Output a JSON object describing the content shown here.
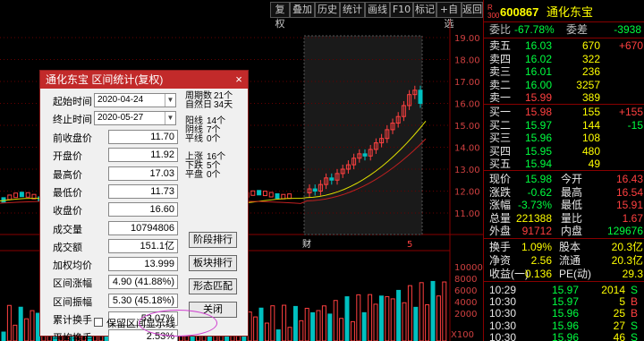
{
  "toolbar": [
    "复权",
    "叠加",
    "历史",
    "统计",
    "画线",
    "F10",
    "标记",
    "+自选",
    "返回"
  ],
  "chart": {
    "price_axis": [
      "19.00",
      "18.00",
      "17.00",
      "16.00",
      "15.00",
      "14.00",
      "13.00",
      "12.00",
      "11.00"
    ],
    "volume_axis": [
      "10000",
      "8000",
      "6000",
      "4000",
      "2000"
    ],
    "volume_unit": "X100",
    "marker_cai": "财",
    "marker_low": "5"
  },
  "stock": {
    "rank": "R\n300",
    "code": "600867",
    "name": "通化东宝"
  },
  "quote": {
    "wb_label": "委比",
    "wb_val": "-67.78%",
    "wc_label": "委差",
    "wc_val": "-3938",
    "sell": [
      {
        "label": "卖五",
        "price": "16.03",
        "vol": "670",
        "chg": "+670"
      },
      {
        "label": "卖四",
        "price": "16.02",
        "vol": "322",
        "chg": ""
      },
      {
        "label": "卖三",
        "price": "16.01",
        "vol": "236",
        "chg": ""
      },
      {
        "label": "卖二",
        "price": "16.00",
        "vol": "3257",
        "chg": ""
      },
      {
        "label": "卖一",
        "price": "15.99",
        "vol": "389",
        "chg": ""
      }
    ],
    "buy": [
      {
        "label": "买一",
        "price": "15.98",
        "vol": "155",
        "chg": "+155"
      },
      {
        "label": "买二",
        "price": "15.97",
        "vol": "144",
        "chg": "-15"
      },
      {
        "label": "买三",
        "price": "15.96",
        "vol": "108",
        "chg": ""
      },
      {
        "label": "买四",
        "price": "15.95",
        "vol": "480",
        "chg": ""
      },
      {
        "label": "买五",
        "price": "15.94",
        "vol": "49",
        "chg": ""
      }
    ],
    "stats": [
      {
        "l1": "现价",
        "v1": "15.98",
        "l2": "今开",
        "v2": "16.43"
      },
      {
        "l1": "涨跌",
        "v1": "-0.62",
        "l2": "最高",
        "v2": "16.54"
      },
      {
        "l1": "涨幅",
        "v1": "-3.73%",
        "l2": "最低",
        "v2": "15.91"
      },
      {
        "l1": "总量",
        "v1": "221388",
        "l2": "量比",
        "v2": "1.67"
      },
      {
        "l1": "外盘",
        "v1": "91712",
        "l2": "内盘",
        "v2": "129676"
      }
    ],
    "stats2": [
      {
        "l1": "换手",
        "v1": "1.09%",
        "l2": "股本",
        "v2": "20.3亿"
      },
      {
        "l1": "净资",
        "v1": "2.56",
        "l2": "流通",
        "v2": "20.3亿"
      },
      {
        "l1": "收益(一)",
        "v1": "0.136",
        "l2": "PE(动)",
        "v2": "29.3"
      }
    ],
    "ticks": [
      {
        "time": "10:29",
        "price": "15.97",
        "vol": "2014",
        "flag": "S"
      },
      {
        "time": "10:30",
        "price": "15.97",
        "vol": "5",
        "flag": "B"
      },
      {
        "time": "10:30",
        "price": "15.96",
        "vol": "25",
        "flag": "B"
      },
      {
        "time": "10:30",
        "price": "15.96",
        "vol": "27",
        "flag": "S"
      },
      {
        "time": "10:30",
        "price": "15.96",
        "vol": "46",
        "flag": "S"
      }
    ]
  },
  "dialog": {
    "title": "通化东宝 区间统计(复权)",
    "close": "×",
    "start_label": "起始时间",
    "start_val": "2020-04-24",
    "end_label": "终止时间",
    "end_val": "2020-05-27",
    "period_label": "周期数",
    "period_val": "21个",
    "natural_label": "自然日",
    "natural_val": "34天",
    "yang_label": "阳线",
    "yang_val": "14个",
    "yin_label": "阴线",
    "yin_val": "7个",
    "ping_label": "平线",
    "ping_val": "0个",
    "up_label": "上涨",
    "up_val": "16个",
    "down_label": "下跌",
    "down_val": "5个",
    "flat_label": "平盘",
    "flat_val": "0个",
    "fields": [
      {
        "label": "前收盘价",
        "val": "11.70"
      },
      {
        "label": "开盘价",
        "val": "11.92"
      },
      {
        "label": "最高价",
        "val": "17.03"
      },
      {
        "label": "最低价",
        "val": "11.73"
      },
      {
        "label": "收盘价",
        "val": "16.60"
      },
      {
        "label": "成交量",
        "val": "10794806"
      },
      {
        "label": "成交额",
        "val": "151.1亿"
      },
      {
        "label": "加权均价",
        "val": "13.999"
      },
      {
        "label": "区间涨幅",
        "val": "4.90 (41.88%)"
      },
      {
        "label": "区间振幅",
        "val": "5.30 (45.18%)"
      },
      {
        "label": "累计换手",
        "val": "53.07%"
      },
      {
        "label": "平均换手",
        "val": "2.53%"
      }
    ],
    "btn1": "阶段排行",
    "btn2": "板块排行",
    "btn3": "形态匹配",
    "btn4": "关闭",
    "checkbox_label": "保留区间显示线"
  }
}
